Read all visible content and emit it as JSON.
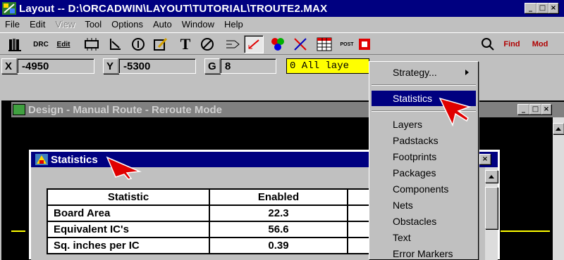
{
  "window": {
    "title": "Layout -- D:\\ORCADWIN\\LAYOUT\\TUTORIAL\\TROUTE2.MAX",
    "min": "_",
    "max": "□",
    "close": "×"
  },
  "menubar": [
    {
      "label": "File",
      "disabled": false
    },
    {
      "label": "Edit",
      "disabled": false
    },
    {
      "label": "View",
      "disabled": true
    },
    {
      "label": "Tool",
      "disabled": false
    },
    {
      "label": "Options",
      "disabled": false
    },
    {
      "label": "Auto",
      "disabled": false
    },
    {
      "label": "Window",
      "disabled": false
    },
    {
      "label": "Help",
      "disabled": false
    }
  ],
  "toolbar": {
    "drc": "DRC",
    "edit": "Edit",
    "post": "POST",
    "find": "Find",
    "mod": "Mod"
  },
  "coords": {
    "x_label": "X",
    "x_value": "-4950",
    "y_label": "Y",
    "y_value": "-5300",
    "g_label": "G",
    "g_value": "8",
    "layer": "0 All laye"
  },
  "design_window": {
    "title": "Design - Manual Route - Reroute Mode"
  },
  "statistics_window": {
    "title": "Statistics",
    "headers": [
      "Statistic",
      "Enabled"
    ],
    "rows": [
      {
        "name": "Board Area",
        "enabled": "22.3"
      },
      {
        "name": "Equivalent IC's",
        "enabled": "56.6"
      },
      {
        "name": "Sq. inches per IC",
        "enabled": "0.39"
      }
    ]
  },
  "dropdown_menu": {
    "strategy": "Strategy...",
    "items": [
      "Statistics",
      "Layers",
      "Padstacks",
      "Footprints",
      "Packages",
      "Components",
      "Nets",
      "Obstacles",
      "Text",
      "Error Markers"
    ],
    "selected": "Statistics"
  },
  "colors": {
    "titlebar": "#000080",
    "inactive_titlebar": "#808080",
    "face": "#c0c0c0",
    "layer_highlight": "#ffff00",
    "cursor": "#e00000"
  }
}
